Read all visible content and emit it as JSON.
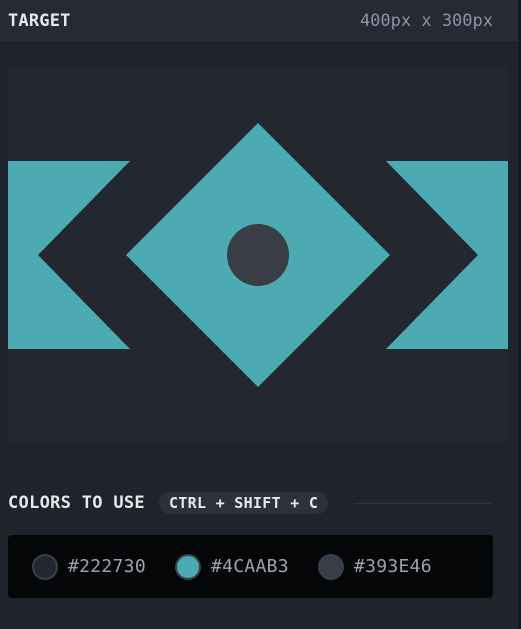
{
  "header": {
    "title": "TARGET",
    "size": "400px x 300px"
  },
  "target": {
    "background": "#222730",
    "shape_color": "#4CAAB3",
    "circle_color": "#393E46"
  },
  "colors_section": {
    "label": "COLORS TO USE",
    "shortcut": "CTRL + SHIFT + C",
    "swatches": [
      {
        "hex": "#222730",
        "label": "#222730"
      },
      {
        "hex": "#4CAAB3",
        "label": "#4CAAB3"
      },
      {
        "hex": "#393E46",
        "label": "#393E46"
      }
    ]
  }
}
